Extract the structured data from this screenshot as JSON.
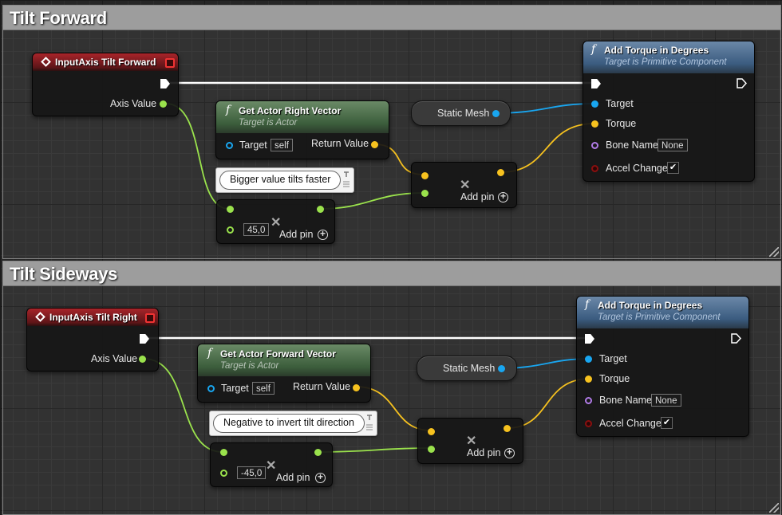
{
  "comments": [
    {
      "title": "Tilt Forward"
    },
    {
      "title": "Tilt Sideways"
    }
  ],
  "colors": {
    "exec": "#ffffff",
    "float": "#9ae24c",
    "vector": "#f7c21f",
    "object": "#19a6f0",
    "name": "#b07be6",
    "bool": "#8a0f0f",
    "event_header": "#a8242a",
    "function_header": "#3c5e3c",
    "target_header": "#3b5c80"
  },
  "forward": {
    "event": {
      "title": "InputAxis Tilt Forward",
      "axis_label": "Axis Value",
      "icon": "event-diamond-icon"
    },
    "get_vector": {
      "title": "Get Actor Right Vector",
      "subtitle": "Target is Actor",
      "target_label": "Target",
      "target_value": "self",
      "return_label": "Return Value"
    },
    "static_mesh": {
      "label": "Static Mesh"
    },
    "multiply_vec": {
      "add_pin": "Add pin"
    },
    "multiply_float": {
      "value": "45,0",
      "add_pin": "Add pin"
    },
    "comment_bubble": {
      "text": "Bigger value tilts faster"
    },
    "add_torque": {
      "title": "Add Torque in Degrees",
      "subtitle": "Target is Primitive Component",
      "target_label": "Target",
      "torque_label": "Torque",
      "bone_label": "Bone Name",
      "bone_value": "None",
      "accel_label": "Accel Change",
      "accel_checked": "✔"
    }
  },
  "sideways": {
    "event": {
      "title": "InputAxis Tilt Right",
      "axis_label": "Axis Value",
      "icon": "event-diamond-icon"
    },
    "get_vector": {
      "title": "Get Actor Forward Vector",
      "subtitle": "Target is Actor",
      "target_label": "Target",
      "target_value": "self",
      "return_label": "Return Value"
    },
    "static_mesh": {
      "label": "Static Mesh"
    },
    "multiply_vec": {
      "add_pin": "Add pin"
    },
    "multiply_float": {
      "value": "-45,0",
      "add_pin": "Add pin"
    },
    "comment_bubble": {
      "text": "Negative to invert tilt direction"
    },
    "add_torque": {
      "title": "Add Torque in Degrees",
      "subtitle": "Target is Primitive Component",
      "target_label": "Target",
      "torque_label": "Torque",
      "bone_label": "Bone Name",
      "bone_value": "None",
      "accel_label": "Accel Change",
      "accel_checked": "✔"
    }
  }
}
